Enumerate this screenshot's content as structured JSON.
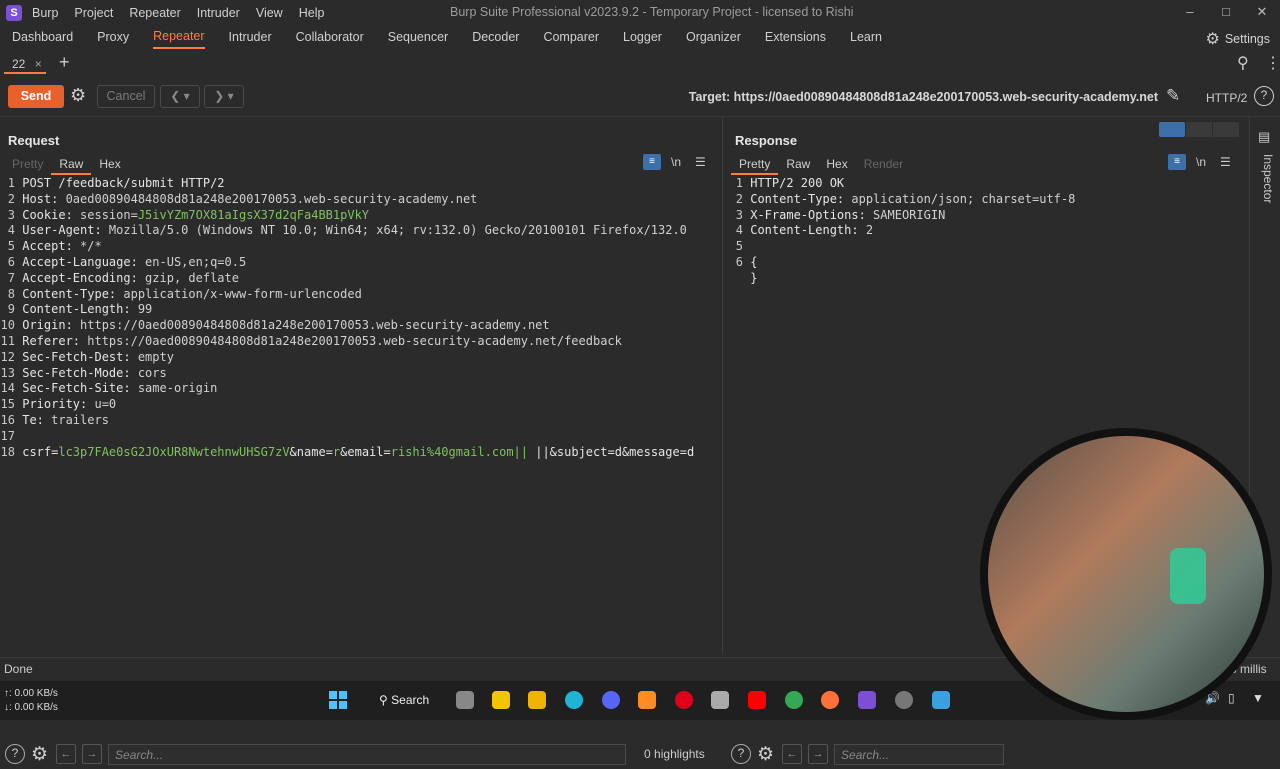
{
  "app": {
    "logo": "S",
    "menu": [
      "Burp",
      "Project",
      "Repeater",
      "Intruder",
      "View",
      "Help"
    ],
    "window_title": "Burp Suite Professional v2023.9.2 - Temporary Project - licensed to Rishi"
  },
  "tabs": [
    "Dashboard",
    "Proxy",
    "Repeater",
    "Intruder",
    "Collaborator",
    "Sequencer",
    "Decoder",
    "Comparer",
    "Logger",
    "Organizer",
    "Extensions",
    "Learn"
  ],
  "active_tab": "Repeater",
  "settings_label": "Settings",
  "subtab": {
    "label": "22",
    "close": "×",
    "add": "+"
  },
  "toolbar": {
    "send": "Send",
    "cancel": "Cancel",
    "target": "Target: https://0aed00890484808d81a248e200170053.web-security-academy.net",
    "http_version": "HTTP/2"
  },
  "request": {
    "title": "Request",
    "tabs": [
      "Pretty",
      "Raw",
      "Hex"
    ],
    "active_tab": "Raw",
    "newline_label": "\\n",
    "lines": [
      {
        "n": "1",
        "k": "POST /feedback/submit HTTP/2",
        "v": ""
      },
      {
        "n": "2",
        "k": "Host:",
        "v": " 0aed00890484808d81a248e200170053.web-security-academy.net"
      },
      {
        "n": "3",
        "k": "Cookie:",
        "v": " session=",
        "g": "J5ivYZm7OX81aIgsX37d2qFa4BB1pVkY"
      },
      {
        "n": "4",
        "k": "User-Agent:",
        "v": " Mozilla/5.0 (Windows NT 10.0; Win64; x64; rv:132.0) Gecko/20100101 Firefox/132.0"
      },
      {
        "n": "5",
        "k": "Accept:",
        "v": " */*"
      },
      {
        "n": "6",
        "k": "Accept-Language:",
        "v": " en-US,en;q=0.5"
      },
      {
        "n": "7",
        "k": "Accept-Encoding:",
        "v": " gzip, deflate"
      },
      {
        "n": "8",
        "k": "Content-Type:",
        "v": " application/x-www-form-urlencoded"
      },
      {
        "n": "9",
        "k": "Content-Length:",
        "v": " 99"
      },
      {
        "n": "10",
        "k": "Origin:",
        "v": " https://0aed00890484808d81a248e200170053.web-security-academy.net"
      },
      {
        "n": "11",
        "k": "Referer:",
        "v": " https://0aed00890484808d81a248e200170053.web-security-academy.net/feedback"
      },
      {
        "n": "12",
        "k": "Sec-Fetch-Dest:",
        "v": " empty"
      },
      {
        "n": "13",
        "k": "Sec-Fetch-Mode:",
        "v": " cors"
      },
      {
        "n": "14",
        "k": "Sec-Fetch-Site:",
        "v": " same-origin"
      },
      {
        "n": "15",
        "k": "Priority:",
        "v": " u=0"
      },
      {
        "n": "16",
        "k": "Te:",
        "v": " trailers"
      },
      {
        "n": "17",
        "k": "",
        "v": ""
      }
    ],
    "body_line_no": "18",
    "body": [
      {
        "t": "csrf=",
        "c": "k"
      },
      {
        "t": "lc3p7FAe0sG2JOxUR8NwtehnwUHSG7zV",
        "c": "g"
      },
      {
        "t": "&name=",
        "c": "k"
      },
      {
        "t": "r",
        "c": "g"
      },
      {
        "t": "&email=",
        "c": "k"
      },
      {
        "t": "rishi%40gmail.com||",
        "c": "g"
      },
      {
        "t": " ||&subject=d&message=d",
        "c": "k"
      }
    ],
    "search_placeholder": "Search...",
    "highlights": "0 highlights"
  },
  "response": {
    "title": "Response",
    "tabs": [
      "Pretty",
      "Raw",
      "Hex",
      "Render"
    ],
    "active_tab": "Pretty",
    "newline_label": "\\n",
    "lines": [
      {
        "n": "1",
        "k": "HTTP/2 200 OK",
        "v": ""
      },
      {
        "n": "2",
        "k": "Content-Type:",
        "v": " application/json; charset=utf-8"
      },
      {
        "n": "3",
        "k": "X-Frame-Options:",
        "v": " SAMEORIGIN"
      },
      {
        "n": "4",
        "k": "Content-Length:",
        "v": " 2"
      },
      {
        "n": "5",
        "k": "",
        "v": ""
      },
      {
        "n": "6",
        "k": "{",
        "v": ""
      },
      {
        "n": "",
        "k": "}",
        "v": ""
      }
    ],
    "search_placeholder": "Search..."
  },
  "inspector_label": "Inspector",
  "status": {
    "text": "Done",
    "right": "3 millis"
  },
  "taskbar": {
    "net_up": "↑: 0.00 KB/s",
    "net_down": "↓: 0.00 KB/s",
    "search_label": "Search"
  },
  "colors": {
    "accent": "#ff7b42",
    "send": "#e8602c",
    "green": "#7fc25d",
    "wrap_icon": "#3d6fa8"
  }
}
